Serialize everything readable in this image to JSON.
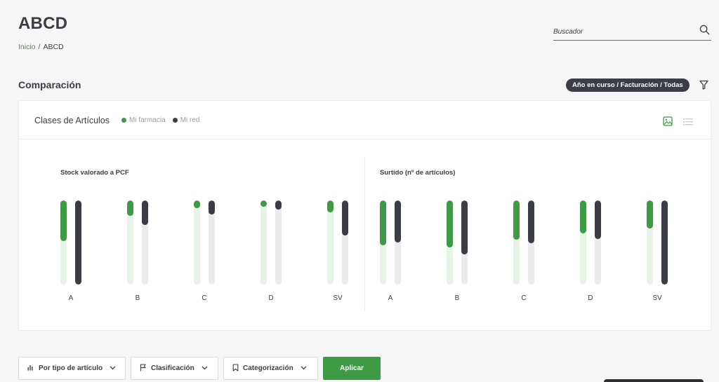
{
  "header": {
    "title": "ABCD",
    "breadcrumb": {
      "home": "Inicio",
      "separator": "/",
      "current": "ABCD"
    },
    "search": {
      "placeholder": "Buscador",
      "value": ""
    }
  },
  "section": {
    "title": "Comparación",
    "filter_badge": "Año en curso / Facturación / Todas"
  },
  "card": {
    "title": "Clases de Artículos",
    "legend": [
      {
        "label": "Mi farmacia",
        "color": "#3f9a45"
      },
      {
        "label": "Mi red",
        "color": "#3a3d44"
      }
    ]
  },
  "colors": {
    "green": "#3f9a45",
    "dark": "#3a3d44",
    "green_track": "#e8f3e8",
    "dark_track": "#ebebed"
  },
  "chart_data": [
    {
      "type": "bar",
      "title": "Stock valorado a PCF",
      "categories": [
        "A",
        "B",
        "C",
        "D",
        "SV"
      ],
      "ylim": [
        0,
        100
      ],
      "series": [
        {
          "name": "Mi farmacia",
          "values": [
            48,
            18,
            9,
            7,
            14
          ]
        },
        {
          "name": "Mi red",
          "values": [
            100,
            29,
            17,
            11,
            42
          ]
        }
      ]
    },
    {
      "type": "bar",
      "title": "Surtido (nº de artículos)",
      "categories": [
        "A",
        "B",
        "C",
        "D",
        "SV"
      ],
      "ylim": [
        0,
        100
      ],
      "series": [
        {
          "name": "Mi farmacia",
          "values": [
            53,
            56,
            47,
            39,
            33
          ]
        },
        {
          "name": "Mi red",
          "values": [
            50,
            64,
            51,
            46,
            100
          ]
        }
      ]
    }
  ],
  "toolbar": {
    "by_type": "Por tipo de artículo",
    "classification": "Clasificación",
    "categorization": "Categorización",
    "apply": "Aplicar"
  }
}
